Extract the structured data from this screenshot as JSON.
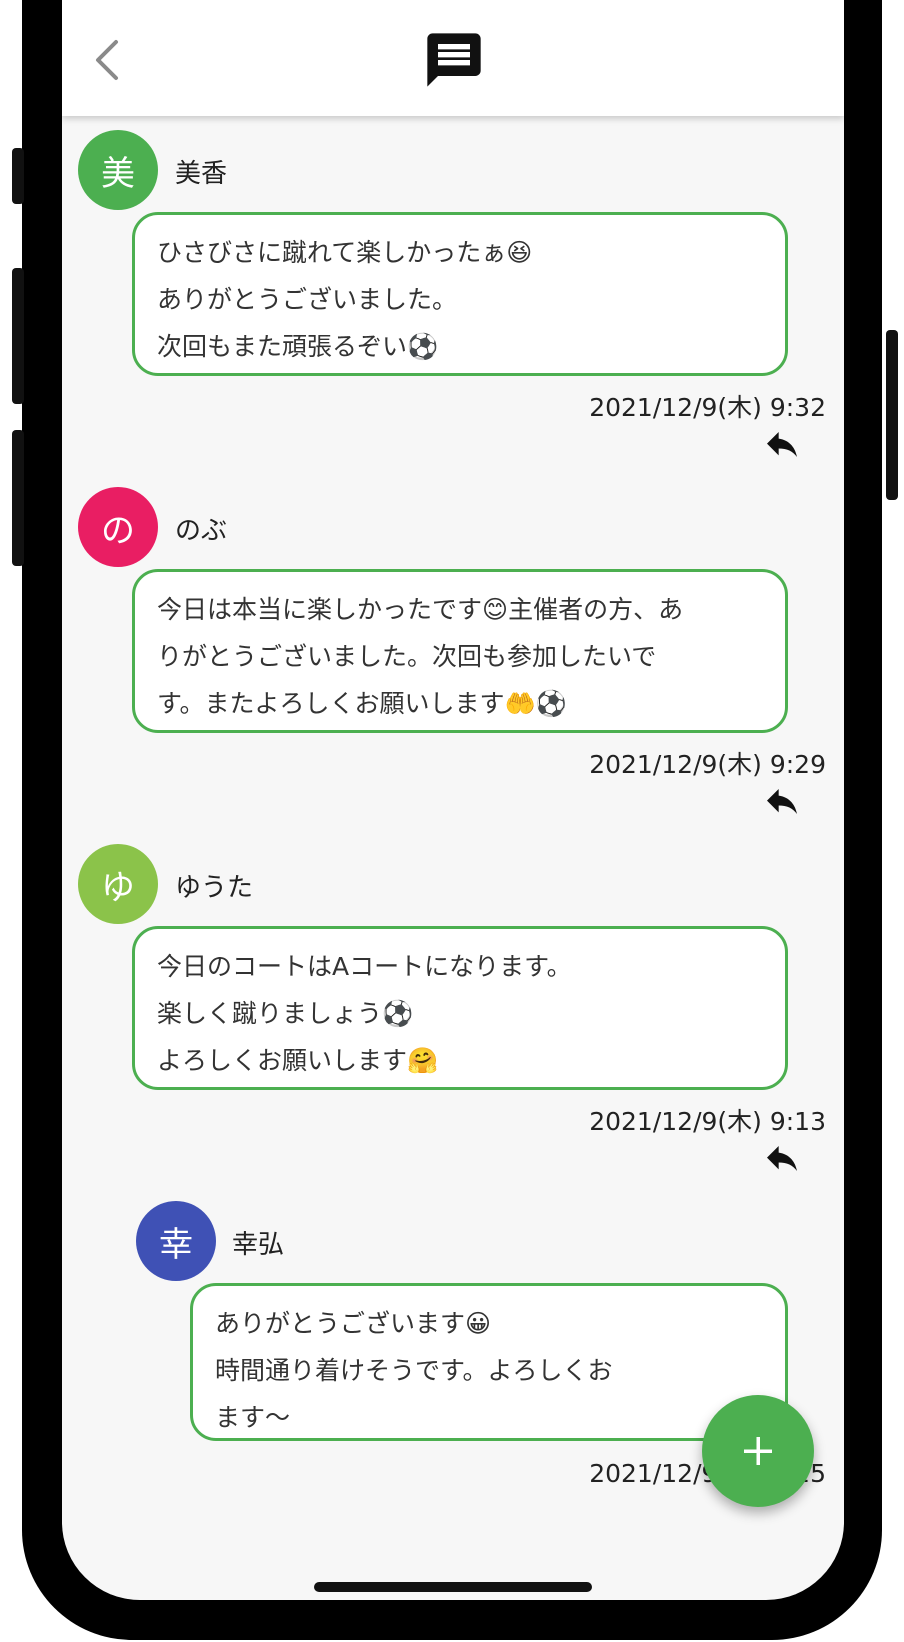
{
  "header": {
    "back_icon": "chevron-left-icon",
    "title_icon": "message-icon"
  },
  "messages": [
    {
      "avatar": "美",
      "avatar_color": "#4caf50",
      "name": "美香",
      "lines": [
        "ひさびさに蹴れて楽しかったぁ😆",
        "ありがとうございました。",
        "次回もまた頑張るぞい⚽"
      ],
      "time": "2021/12/9(木) 9:32"
    },
    {
      "avatar": "の",
      "avatar_color": "#e91e63",
      "name": "のぶ",
      "lines": [
        "今日は本当に楽しかったです😊主催者の方、あ",
        "りがとうございました。次回も参加したいで",
        "す。またよろしくお願いします🤲⚽"
      ],
      "time": "2021/12/9(木) 9:29"
    },
    {
      "avatar": "ゆ",
      "avatar_color": "#8bc34a",
      "name": "ゆうた",
      "lines": [
        "今日のコートはAコートになります。",
        "楽しく蹴りましょう⚽",
        "よろしくお願いします🤗"
      ],
      "time": "2021/12/9(木) 9:13"
    }
  ],
  "reply": {
    "avatar": "幸",
    "avatar_color": "#3f51b5",
    "name": "幸弘",
    "lines": [
      "ありがとうございます😀",
      "時間通り着けそうです。よろしくお",
      "ます〜"
    ],
    "time": "2021/12/9(木) 9:25"
  },
  "reply_icon": "reply-icon",
  "fab": {
    "label": "+",
    "icon": "add-icon",
    "color": "#4caf50"
  }
}
